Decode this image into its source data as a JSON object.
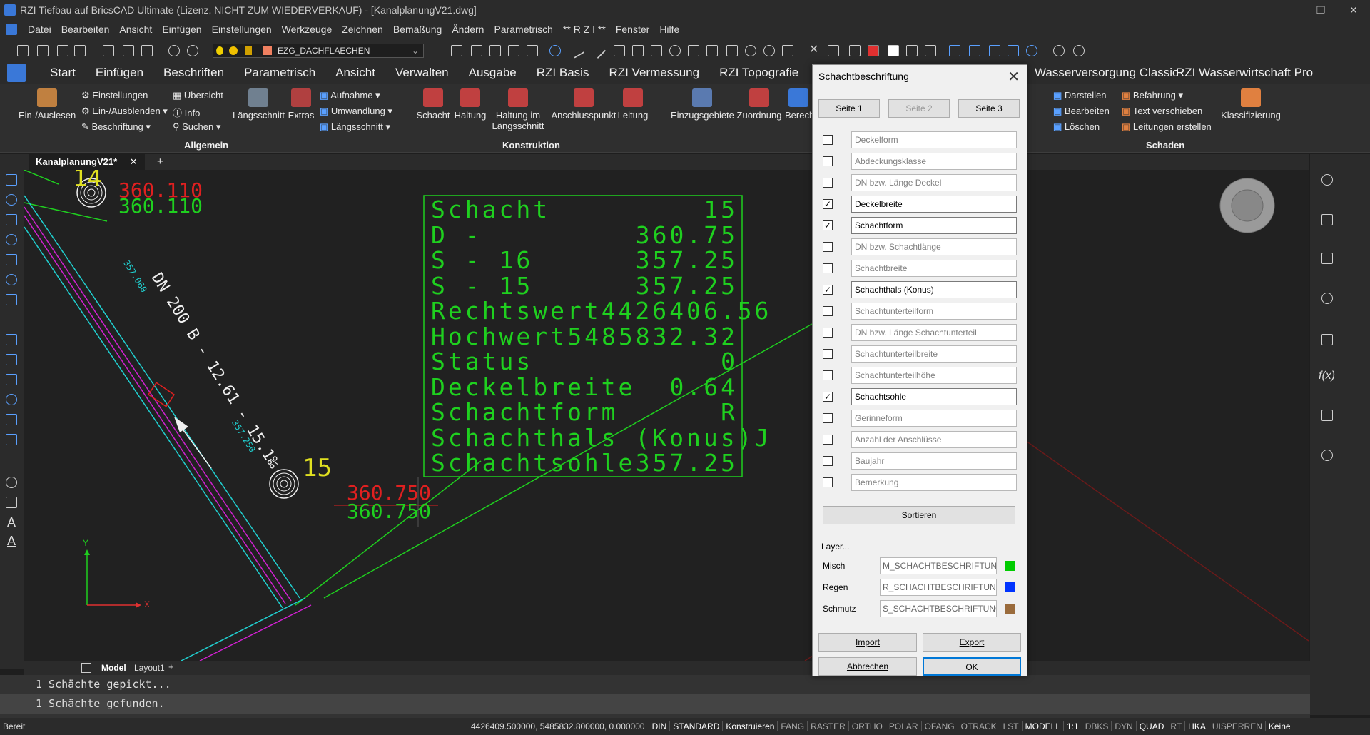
{
  "window": {
    "title": "RZI Tiefbau auf BricsCAD Ultimate (Lizenz, NICHT ZUM WIEDERVERKAUF) - [KanalplanungV21.dwg]"
  },
  "menu": [
    "Datei",
    "Bearbeiten",
    "Ansicht",
    "Einfügen",
    "Einstellungen",
    "Werkzeuge",
    "Zeichnen",
    "Bemaßung",
    "Ändern",
    "Parametrisch",
    "** R Z I **",
    "Fenster",
    "Hilfe"
  ],
  "layer_combo": "EZG_DACHFLAECHEN",
  "ribbon_tabs": [
    "Start",
    "Einfügen",
    "Beschriften",
    "Parametrisch",
    "Ansicht",
    "Verwalten",
    "Ausgabe",
    "RZI Basis",
    "RZI Vermessung",
    "RZI Topografie",
    "Wasserversorgung Classic",
    "RZI Wasserwirtschaft Pro"
  ],
  "ribbon": {
    "allgemein": {
      "big": "Ein-/Auslesen",
      "small": [
        "Einstellungen",
        "Ein-/Ausblenden",
        "Beschriftung",
        "Übersicht",
        "Info",
        "Suchen"
      ],
      "more": [
        "Längsschnitt",
        "Extras",
        "Aufnahme",
        "Umwandlung",
        "Längsschnitt"
      ],
      "label": "Allgemein"
    },
    "konstruktion": {
      "buttons": [
        "Schacht",
        "Haltung",
        "Haltung im",
        "Längsschnitt",
        "Anschlusspunkt",
        "Leitung"
      ],
      "label": "Konstruktion"
    },
    "ezg": {
      "buttons": [
        "Einzugsgebiete",
        "Zuordnung",
        "Berech"
      ]
    },
    "schaden": {
      "small": [
        "Darstellen",
        "Bearbeiten",
        "Löschen",
        "Befahrung",
        "Text verschieben",
        "Leitungen erstellen"
      ],
      "big": "Klassifizierung",
      "label": "Schaden"
    }
  },
  "doc_tab": "KanalplanungV21*",
  "drawing": {
    "node14": {
      "num": "14",
      "red": "360.110",
      "green": "360.110"
    },
    "node15": {
      "num": "15",
      "red": "360.750",
      "green": "360.750"
    },
    "pipe_label": "DN 200 B - 12.61 - 15.1‰",
    "stat_a": "357.060",
    "stat_b": "357.250",
    "box_rows": [
      [
        "Schacht",
        "15"
      ],
      [
        "D -",
        "360.75"
      ],
      [
        "S - 16",
        "357.25"
      ],
      [
        "S - 15",
        "357.25"
      ],
      [
        "Rechtswert",
        "4426406.56"
      ],
      [
        "Hochwert",
        "5485832.32"
      ],
      [
        "Status",
        "0"
      ],
      [
        "Deckelbreite",
        "0.64"
      ],
      [
        "Schachtform",
        "R"
      ],
      [
        "Schachthals (Konus)",
        "J"
      ],
      [
        "Schachtsohle",
        "357.25"
      ]
    ],
    "axis_x": "X",
    "axis_y": "Y"
  },
  "layout_tabs": [
    "Model",
    "Layout1"
  ],
  "command_lines": [
    "1 Schächte gepickt...",
    "1 Schächte gefunden."
  ],
  "status": {
    "ready": "Bereit",
    "coords": "4426409.500000, 5485832.800000, 0.000000",
    "items": [
      "DIN",
      "STANDARD",
      "Konstruieren",
      "FANG",
      "RASTER",
      "ORTHO",
      "POLAR",
      "OFANG",
      "OTRACK",
      "LST",
      "MODELL",
      "1:1",
      "DBKS",
      "DYN",
      "QUAD",
      "RT",
      "HKA",
      "UISPERREN",
      "Keine"
    ]
  },
  "dialog": {
    "title": "Schachtbeschriftung",
    "pages": [
      "Seite 1",
      "Seite 2",
      "Seite 3"
    ],
    "fields": [
      {
        "label": "Deckelform",
        "checked": false
      },
      {
        "label": "Abdeckungsklasse",
        "checked": false
      },
      {
        "label": "DN bzw. Länge Deckel",
        "checked": false
      },
      {
        "label": "Deckelbreite",
        "checked": true
      },
      {
        "label": "Schachtform",
        "checked": true
      },
      {
        "label": "DN bzw. Schachtlänge",
        "checked": false
      },
      {
        "label": "Schachtbreite",
        "checked": false
      },
      {
        "label": "Schachthals (Konus)",
        "checked": true
      },
      {
        "label": "Schachtunterteilform",
        "checked": false
      },
      {
        "label": "DN bzw. Länge Schachtunterteil",
        "checked": false
      },
      {
        "label": "Schachtunterteilbreite",
        "checked": false
      },
      {
        "label": "Schachtunterteilhöhe",
        "checked": false
      },
      {
        "label": "Schachtsohle",
        "checked": true
      },
      {
        "label": "Gerinneform",
        "checked": false
      },
      {
        "label": "Anzahl der Anschlüsse",
        "checked": false
      },
      {
        "label": "Baujahr",
        "checked": false
      },
      {
        "label": "Bemerkung",
        "checked": false
      }
    ],
    "sort_label": "Sortieren",
    "layer_header": "Layer...",
    "layers": [
      {
        "name": "Misch",
        "value": "M_SCHACHTBESCHRIFTUNG",
        "color": "#00cc00"
      },
      {
        "name": "Regen",
        "value": "R_SCHACHTBESCHRIFTUNG",
        "color": "#0033ff"
      },
      {
        "name": "Schmutz",
        "value": "S_SCHACHTBESCHRIFTUNG",
        "color": "#9a6b3c"
      }
    ],
    "import_label": "Import",
    "export_label": "Export",
    "cancel_label": "Abbrechen",
    "ok_label": "OK"
  },
  "colors": {
    "green": "#1fd01f",
    "red": "#e02020",
    "cyan": "#20d0d0",
    "magenta": "#d020d0",
    "yellow": "#e0e020"
  }
}
